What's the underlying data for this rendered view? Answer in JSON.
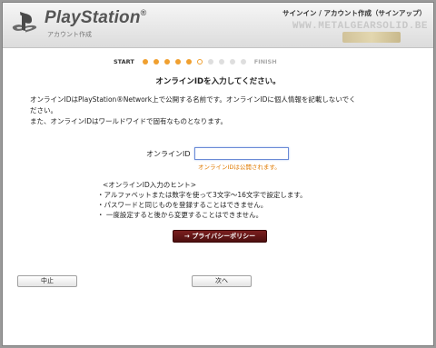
{
  "header": {
    "brand": "PlayStation",
    "brand_mark": "®",
    "subtitle": "アカウント作成",
    "screen_title": "サインイン / アカウント作成（サインアップ）",
    "watermark": "WWW.METALGEARSOLID.BE"
  },
  "progress": {
    "start_label": "START",
    "finish_label": "FINISH",
    "total_steps": 10,
    "current_step": 6
  },
  "prompt": "オンラインIDを入力してください。",
  "description": [
    "オンラインIDはPlayStation®Network上で公開する名前です。オンラインIDに個人情報を記載しないでく",
    "ださい。",
    "また、オンラインIDはワールドワイドで固有なものとなります。"
  ],
  "form": {
    "online_id_label": "オンラインID",
    "online_id_value": "",
    "online_id_note": "オンラインIDは公開されます。"
  },
  "hints": {
    "title": "<オンラインID入力のヒント>",
    "items": [
      "・アルファベットまたは数字を使って3文字〜16文字で設定します。",
      "・パスワードと同じものを登録することはできません。",
      "・ 一度設定すると後から変更することはできません。"
    ]
  },
  "buttons": {
    "privacy_policy": "→ プライバシーポリシー",
    "cancel": "中止",
    "next": "次へ"
  },
  "colors": {
    "progress_accent": "#f0a030",
    "note_text": "#e07a00",
    "policy_button": "#5e1414",
    "input_focus": "#6a8ad6"
  }
}
